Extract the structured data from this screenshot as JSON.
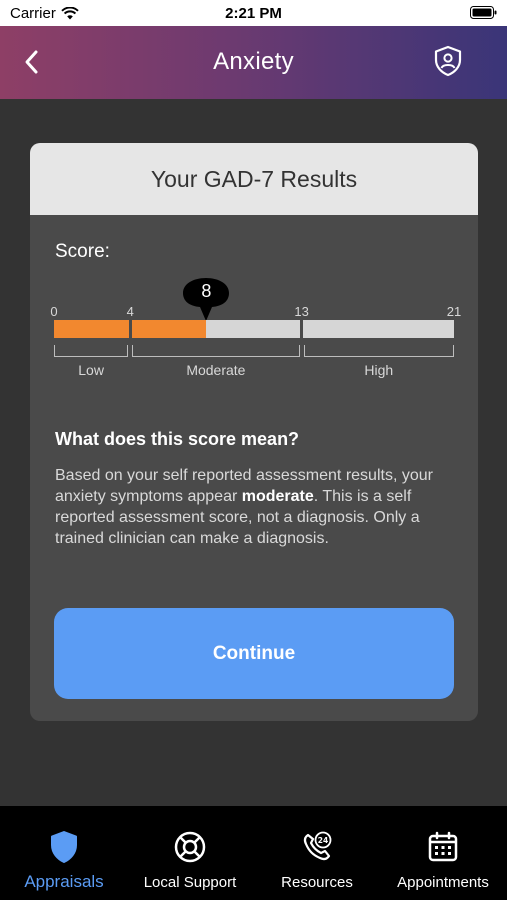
{
  "status_bar": {
    "carrier": "Carrier",
    "time": "2:21 PM"
  },
  "header": {
    "title": "Anxiety",
    "back_icon": "chevron-left-icon",
    "right_icon": "shield-user-icon"
  },
  "card": {
    "title": "Your GAD-7 Results",
    "score_label": "Score:",
    "score": {
      "value": "8",
      "min": 0,
      "max": 21
    },
    "scale": {
      "ticks": [
        "0",
        "4",
        "13",
        "21"
      ],
      "ranges": [
        {
          "label": "Low",
          "from": 0,
          "to": 4
        },
        {
          "label": "Moderate",
          "from": 4,
          "to": 13
        },
        {
          "label": "High",
          "from": 13,
          "to": 21
        }
      ]
    },
    "meaning_title": "What does this score mean?",
    "meaning_text_before": "Based on your self reported assessment results, your anxiety symptoms appear ",
    "meaning_text_bold": "moderate",
    "meaning_text_after": ". This is a self reported assessment score, not a diagnosis. Only a trained clinician can make a diagnosis.",
    "continue_label": "Continue"
  },
  "tabs": [
    {
      "label": "Appraisals",
      "icon": "shield-icon",
      "active": true
    },
    {
      "label": "Local Support",
      "icon": "lifebuoy-icon",
      "active": false
    },
    {
      "label": "Resources",
      "icon": "phone-24-icon",
      "active": false
    },
    {
      "label": "Appointments",
      "icon": "calendar-icon",
      "active": false
    }
  ],
  "colors": {
    "accent": "#5b9cf4",
    "fill": "#f2882f",
    "track": "#d6d6d6"
  }
}
